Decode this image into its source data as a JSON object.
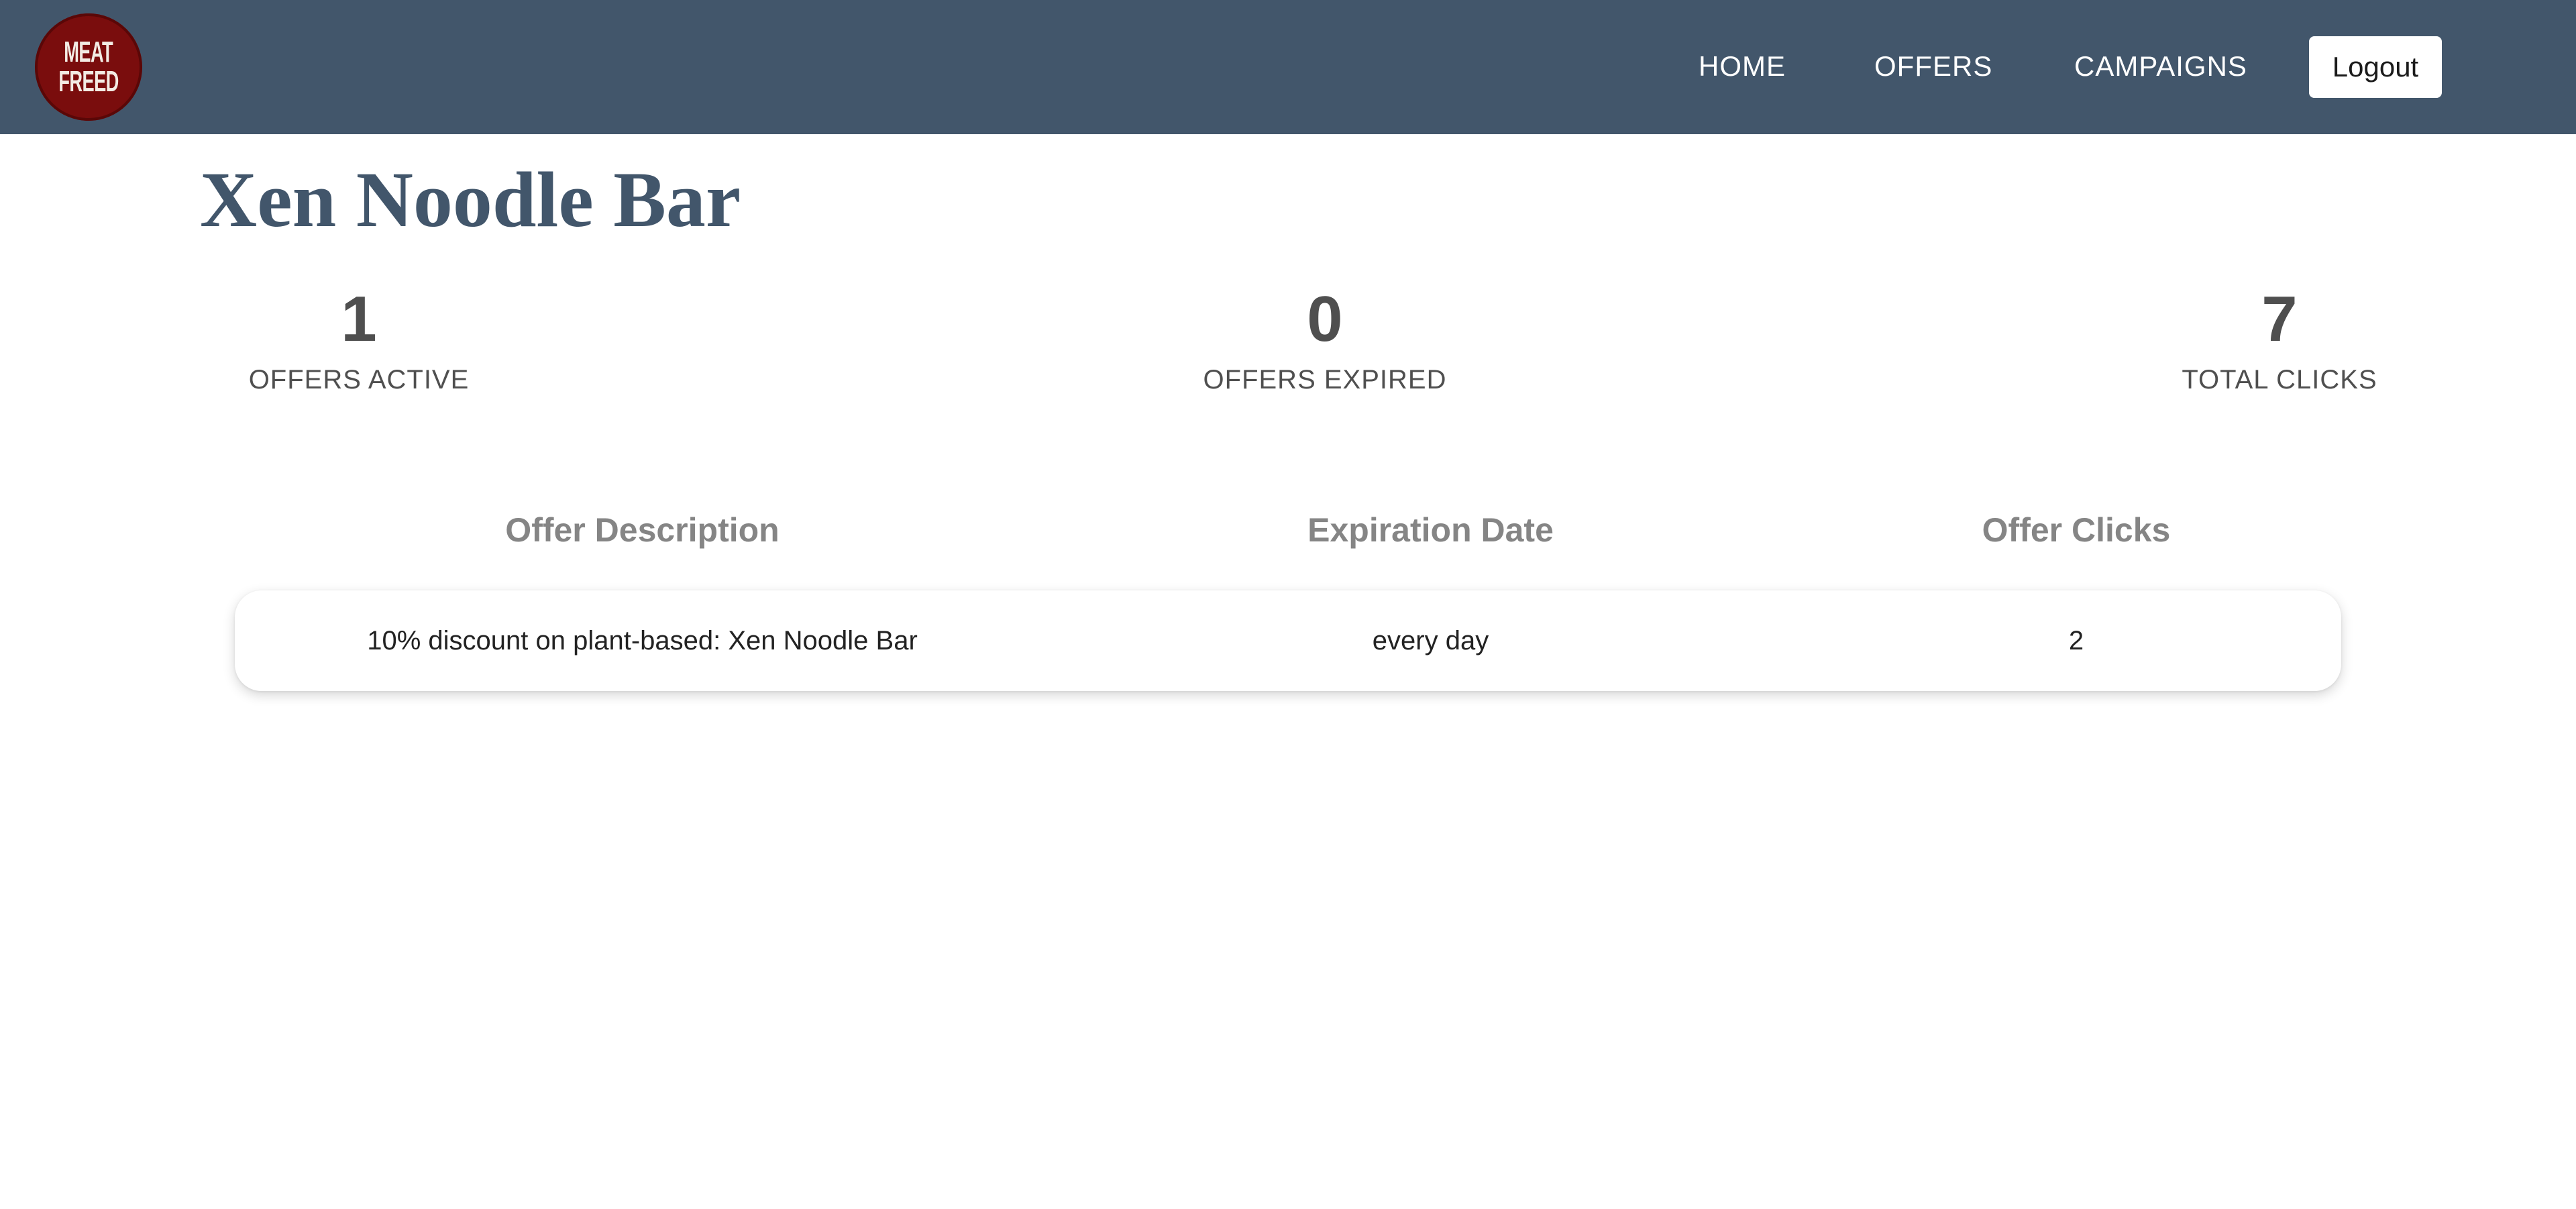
{
  "navbar": {
    "logo": {
      "line1": "MEAT",
      "line2": "FREED",
      "color": "#7a0d0d"
    },
    "links": [
      {
        "label": "HOME"
      },
      {
        "label": "OFFERS"
      },
      {
        "label": "CAMPAIGNS"
      }
    ],
    "logout_label": "Logout",
    "background": "#42566b"
  },
  "page": {
    "title": "Xen Noodle Bar"
  },
  "stats": [
    {
      "value": "1",
      "label": "OFFERS ACTIVE"
    },
    {
      "value": "0",
      "label": "OFFERS EXPIRED"
    },
    {
      "value": "7",
      "label": "TOTAL CLICKS"
    }
  ],
  "table": {
    "headers": [
      "Offer Description",
      "Expiration Date",
      "Offer Clicks"
    ],
    "rows": [
      {
        "description": "10% discount on plant-based: Xen Noodle Bar",
        "expiration": "every day",
        "clicks": "2"
      }
    ]
  }
}
